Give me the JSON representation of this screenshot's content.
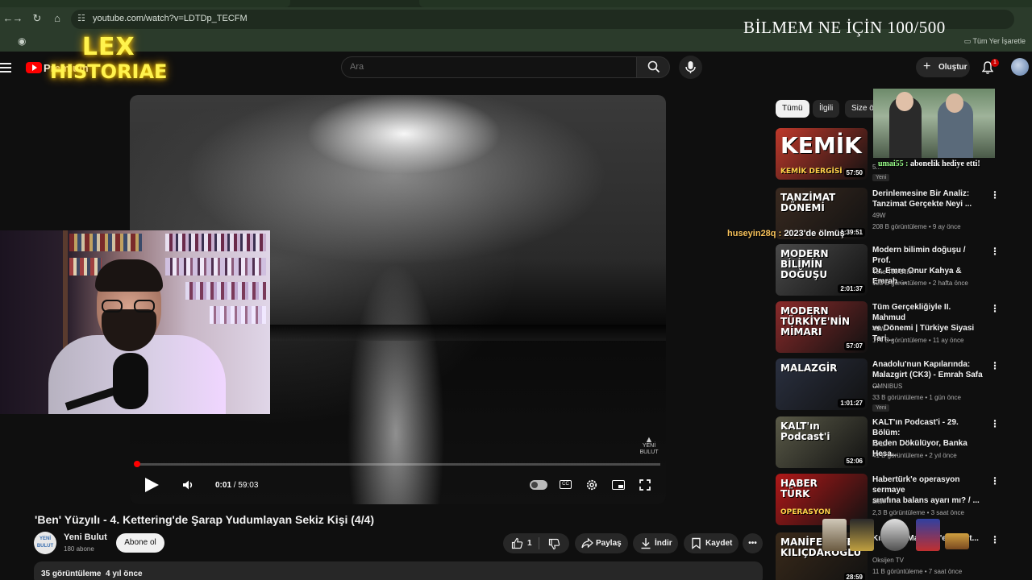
{
  "browser": {
    "url": "youtube.com/watch?v=LDTDp_TECFM",
    "bookmarks_all_label": "Tüm Yer İşaretle"
  },
  "stream_overlay": {
    "title": "BİLMEM NE İÇİN 100/500",
    "logo_line1": "LEX",
    "logo_line2": "HISTORIAE",
    "gift": {
      "user": "umai55 :",
      "text": "abonelik hediye etti!"
    },
    "chat": {
      "user": "huseyin28q :",
      "text": "2023'de ölmüş"
    }
  },
  "header": {
    "logo_text": "Premium",
    "search_placeholder": "Ara",
    "create_label": "Oluştur",
    "notification_count": "1"
  },
  "player": {
    "current_time": "0:01",
    "duration": "59:03",
    "progress_fraction": 0.0003,
    "watermark": "YENİ BULUT"
  },
  "video": {
    "title": "'Ben' Yüzyılı - 4. Kettering'de Şarap Yudumlayan Sekiz Kişi (4/4)",
    "channel": "Yeni Bulut",
    "channel_avatar_text": "YENİ BULUT",
    "subscribers": "180 abone",
    "subscribe_label": "Abone ol",
    "likes": "1",
    "share_label": "Paylaş",
    "download_label": "İndir",
    "save_label": "Kaydet",
    "views": "35 görüntüleme",
    "age": "4 yıl önce"
  },
  "sidebar": {
    "chips": [
      "Tümü",
      "İlgili",
      "Size öz"
    ],
    "items": [
      {
        "title": "",
        "channel": "",
        "meta": "5...",
        "duration": "57:50",
        "badge": "Yeni",
        "thumb_text": "KEMİK",
        "thumb_sub": "KEMİK DERGİSİ",
        "thumb_color": "#c0392b"
      },
      {
        "title": "Derinlemesine Bir Analiz:\nTanzimat Gerçekte Neyi ...",
        "channel": "49W",
        "meta": "208 B görüntüleme • 9 ay önce",
        "duration": "1:39:51",
        "badge": "",
        "thumb_text": "TANZİMAT\nDÖNEMİ",
        "thumb_sub": "",
        "thumb_color": "#3a2a20"
      },
      {
        "title": "Modern bilimin doğuşu / Prof.\nDr. Emre Onur Kahya & Emrah ...",
        "channel": "Teke Tek Bilim",
        "meta": "123 B görüntüleme • 2 hafta önce",
        "duration": "2:01:37",
        "badge": "",
        "thumb_text": "MODERN BİLİMİN\nDOĞUŞU",
        "thumb_sub": "",
        "thumb_color": "#4a4a4a"
      },
      {
        "title": "Tüm Gerçekliğiyle II. Mahmud\nve Dönemi | Türkiye Siyasi Tari...",
        "channel": "49W",
        "meta": "174 B görüntüleme • 11 ay önce",
        "duration": "57:07",
        "badge": "",
        "thumb_text": "MODERN\nTÜRKİYE'NİN\nMİMARI",
        "thumb_sub": "",
        "thumb_color": "#8a2a2a"
      },
      {
        "title": "Anadolu'nun Kapılarında:\nMalazgirt (CK3) - Emrah Safa ...",
        "channel": "OMNIBUS",
        "meta": "33 B görüntüleme • 1 gün önce",
        "duration": "1:01:27",
        "badge": "Yeni",
        "thumb_text": "MALAZGİR",
        "thumb_sub": "",
        "thumb_color": "#2a3040"
      },
      {
        "title": "KALT'ın Podcast'i - 29. Bölüm:\nBeden Dökülüyor, Banka Hesa...",
        "channel": "KALT",
        "meta": "41 B görüntüleme • 2 yıl önce",
        "duration": "52:06",
        "badge": "",
        "thumb_text": "KALT'ın\nPodcast'i",
        "thumb_sub": "",
        "thumb_color": "#5a5a48"
      },
      {
        "title": "Habertürk'e operasyon sermaye\nsınıfına balans ayarı mı? / ...",
        "channel": "alan",
        "meta": "2,3 B görüntüleme • 3 saat önce",
        "duration": "",
        "badge": "",
        "thumb_text": "HABER\nTÜRK",
        "thumb_sub": "OPERASYON",
        "thumb_color": "#b01818"
      },
      {
        "title": "Kılı... ... | Manifest'e gözalt...",
        "channel": "Oksijen TV",
        "meta": "11 B görüntüleme • 7 saat önce",
        "duration": "28:59",
        "badge": "",
        "thumb_text": "MANİFEST VE\nKILIÇDAROĞLU",
        "thumb_sub": "",
        "thumb_color": "#3a2a1a"
      }
    ]
  },
  "colors": {
    "accent": "#ff0000",
    "background": "#0f0f0f",
    "surface": "#272727",
    "text": "#f1f1f1",
    "muted": "#aaaaaa"
  }
}
